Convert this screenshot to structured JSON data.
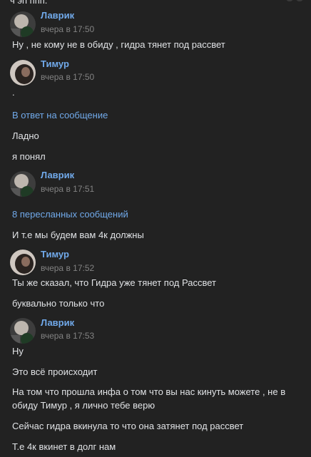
{
  "page": {
    "top_fragment": "ч эп ппп."
  },
  "colors": {
    "background": "#222222",
    "text": "#e1e3e6",
    "author": "#71aaeb",
    "meta": "#828282",
    "link": "#71aaeb"
  },
  "messages": [
    {
      "author": "Лаврик",
      "time": "вчера в 17:50",
      "texts": [
        "Ну , не кому не в обиду , гидра тянет под рассвет"
      ]
    },
    {
      "author": "Тимур",
      "time": "вчера в 17:50",
      "texts": [
        ".",
        "Ладно",
        "я понял"
      ],
      "reply_link": "В ответ на сообщение"
    },
    {
      "author": "Лаврик",
      "time": "вчера в 17:51",
      "forward_link": "8 пересланных сообщений",
      "texts": [
        "И т.е мы будем вам 4к должны"
      ]
    },
    {
      "author": "Тимур",
      "time": "вчера в 17:52",
      "texts": [
        "Ты же сказал, что Гидра уже тянет под Рассвет",
        "буквально только что"
      ]
    },
    {
      "author": "Лаврик",
      "time": "вчера в 17:53",
      "texts": [
        "Ну",
        "Это всё происходит",
        "На том что прошла инфа о том что вы нас кинуть можете , не в обиду Тимур , я лично тебе верю",
        "Сейчас гидра вкинула то что она затянет под рассвет",
        "Т.е 4к вкинет в долг нам"
      ]
    }
  ]
}
